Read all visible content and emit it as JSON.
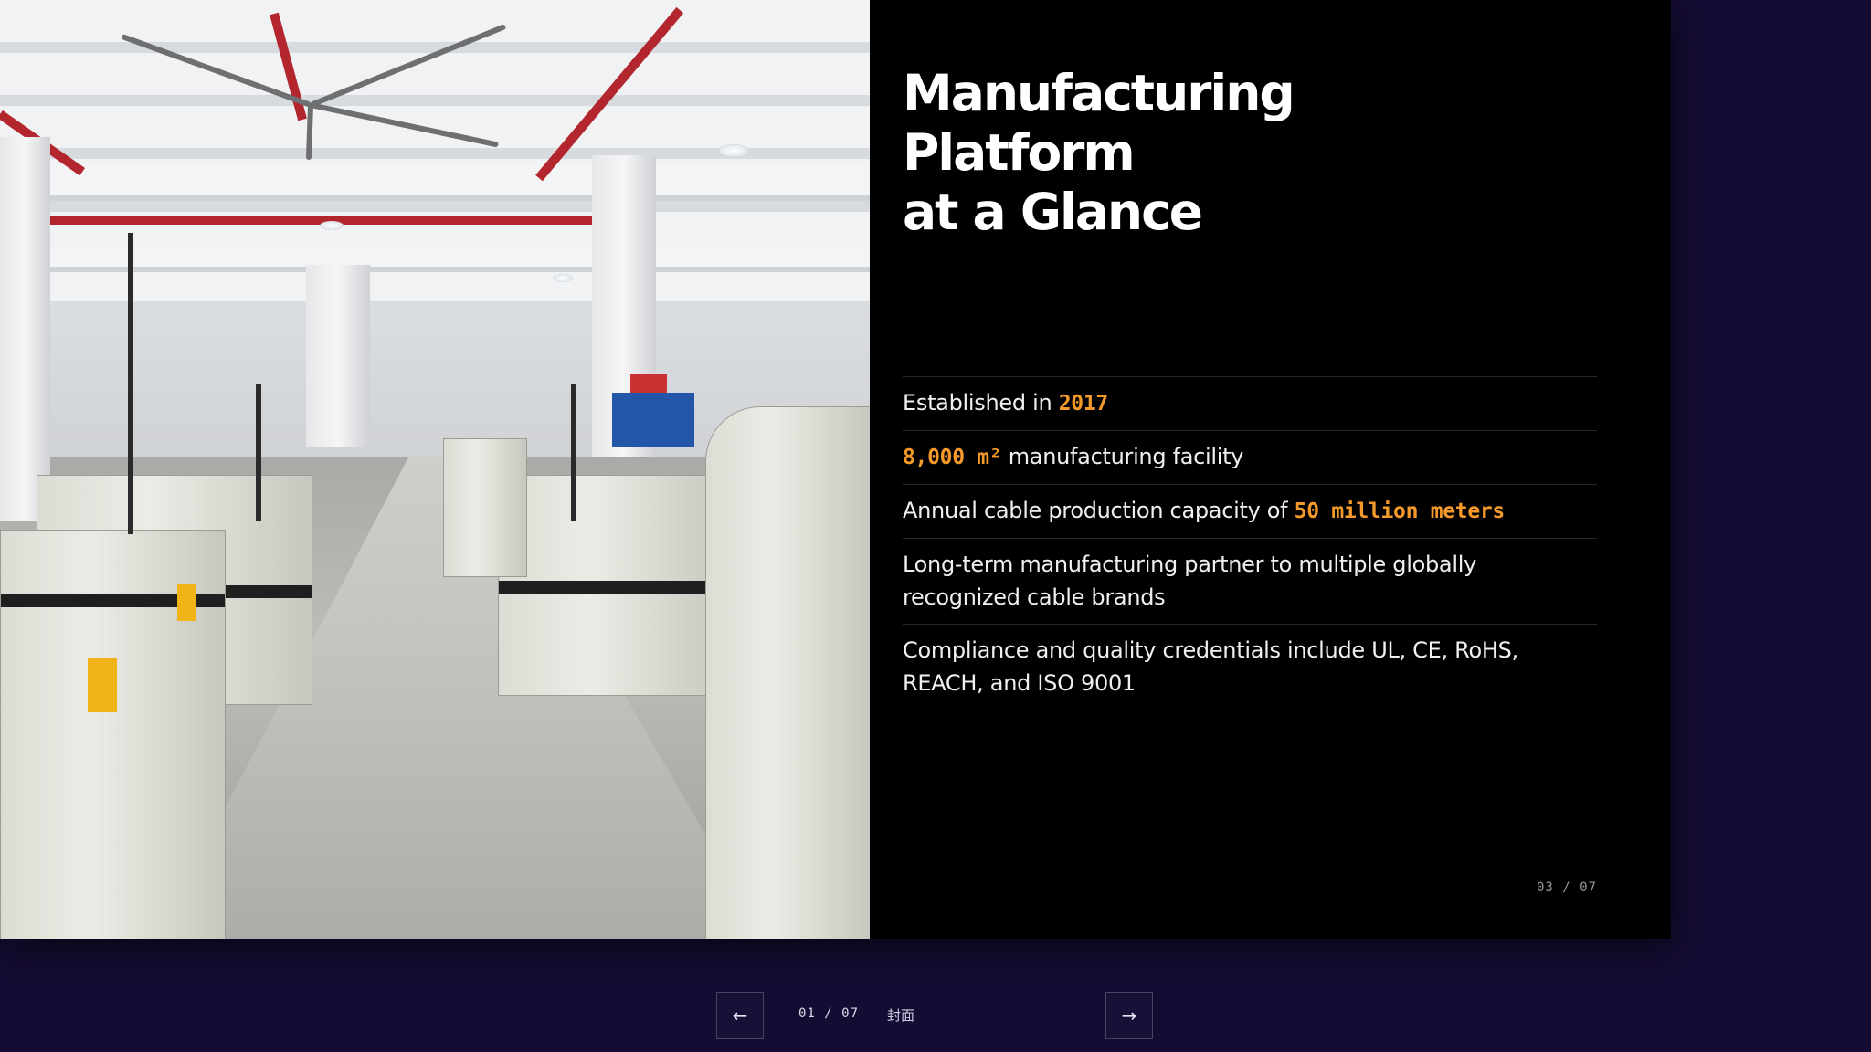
{
  "slide": {
    "title_lines": [
      "Manufacturing",
      "Platform",
      "at a Glance"
    ],
    "facts": [
      {
        "before": "Established in ",
        "highlight": "2017",
        "after": ""
      },
      {
        "before": "",
        "highlight": "8,000 m²",
        "after": " manufacturing facility"
      },
      {
        "before": "Annual cable production capacity of ",
        "highlight": "50 million meters",
        "after": ""
      },
      {
        "before": "Long-term manufacturing partner to multiple globally recognized cable brands",
        "highlight": "",
        "after": ""
      },
      {
        "before": "Compliance and quality credentials include UL, CE, RoHS, REACH, and ISO 9001",
        "highlight": "",
        "after": ""
      }
    ],
    "page_indicator": "03 / 07",
    "photo_icon": "factory-photo"
  },
  "nav": {
    "prev_symbol": "←",
    "next_symbol": "→",
    "counter": "01 / 07",
    "section_label": "封面"
  },
  "colors": {
    "accent": "#f39a2a",
    "background": "#150c33",
    "slide_background": "#000000"
  }
}
